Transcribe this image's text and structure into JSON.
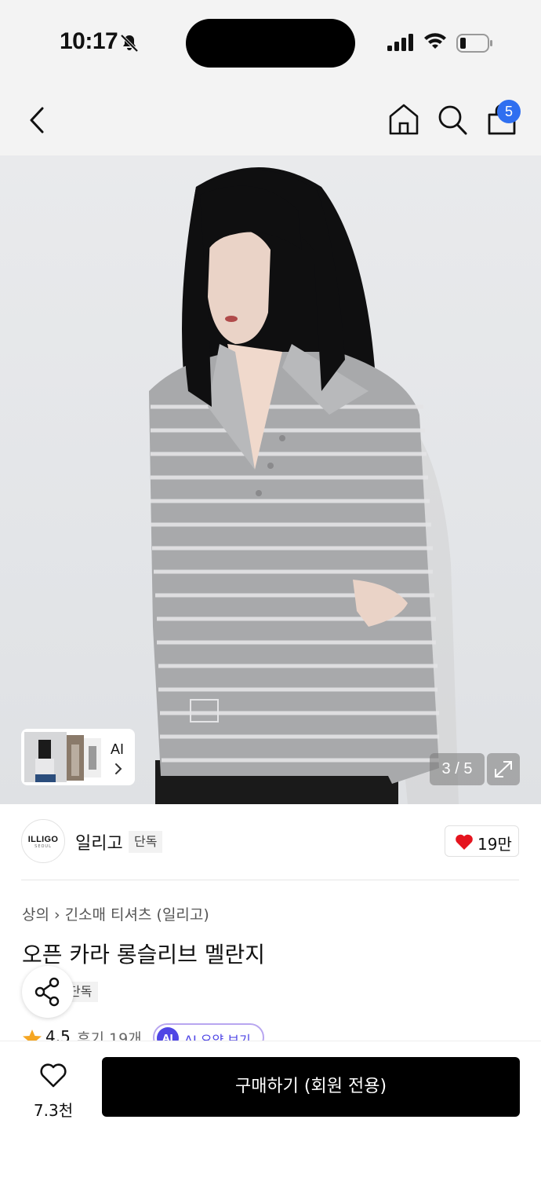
{
  "status_bar": {
    "time": "10:17",
    "icons": [
      "bell-slash-icon",
      "cellular-signal-icon",
      "wifi-icon",
      "battery-icon"
    ]
  },
  "top_nav": {
    "icons": [
      "back-chevron-icon",
      "home-icon",
      "search-icon",
      "shopping-bag-icon"
    ],
    "cart_count": "5"
  },
  "product_image": {
    "ai_button_label": "AI",
    "counter": "3 / 5",
    "expand_icon": "expand-arrows-icon"
  },
  "brand": {
    "logo_text": "ILLIGO",
    "logo_sub": "SEOUL",
    "name": "일리고",
    "exclusive_tag": "단독",
    "like_count": "19만",
    "heart_color": "#e5141e"
  },
  "product": {
    "breadcrumb": [
      "상의",
      "긴소매 티셔츠 (일리고)"
    ],
    "title": "오픈 카라 롱슬리브 멜란지",
    "exclusive_tag": "단독",
    "rating": "4.5",
    "review_count": "후기 19개",
    "ai_summary_badge": "AI",
    "ai_summary_label": "AI 요약 보기",
    "star_color": "#f5a623"
  },
  "bottom_bar": {
    "wishlist_count": "7.3천",
    "buy_label": "구매하기 (회원 전용)"
  },
  "colors": {
    "accent_badge": "#2f6ff0",
    "ai_purple": "#4f46e5",
    "buy_button": "#000000"
  }
}
